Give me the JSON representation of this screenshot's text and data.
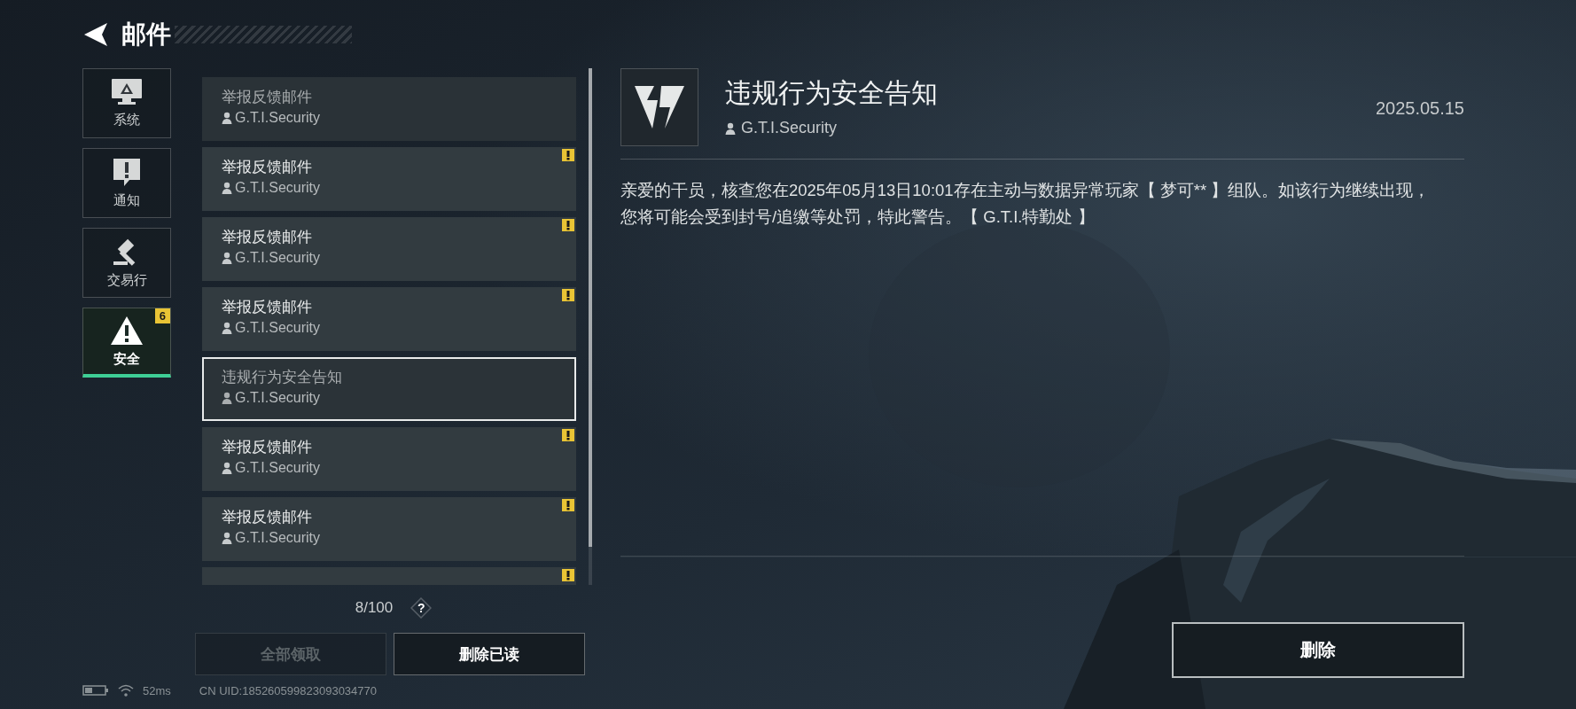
{
  "header": {
    "title": "邮件"
  },
  "tabs": [
    {
      "label": "系统",
      "kind": "monitor",
      "selected": false
    },
    {
      "label": "通知",
      "kind": "notice",
      "selected": false
    },
    {
      "label": "交易行",
      "kind": "hammer",
      "selected": false
    },
    {
      "label": "安全",
      "kind": "warning",
      "selected": true,
      "badge": "6"
    }
  ],
  "mails": [
    {
      "title": "举报反馈邮件",
      "sender": "G.T.I.Security",
      "unread": false,
      "selected": false
    },
    {
      "title": "举报反馈邮件",
      "sender": "G.T.I.Security",
      "unread": true,
      "selected": false
    },
    {
      "title": "举报反馈邮件",
      "sender": "G.T.I.Security",
      "unread": true,
      "selected": false
    },
    {
      "title": "举报反馈邮件",
      "sender": "G.T.I.Security",
      "unread": true,
      "selected": false
    },
    {
      "title": "违规行为安全告知",
      "sender": "G.T.I.Security",
      "unread": false,
      "selected": true
    },
    {
      "title": "举报反馈邮件",
      "sender": "G.T.I.Security",
      "unread": true,
      "selected": false
    },
    {
      "title": "举报反馈邮件",
      "sender": "G.T.I.Security",
      "unread": true,
      "selected": false
    },
    {
      "unread": true,
      "selected": false
    }
  ],
  "counter": "8/100",
  "help": "?",
  "list_buttons": [
    {
      "label": "全部领取",
      "disabled": true
    },
    {
      "label": "删除已读",
      "disabled": false
    }
  ],
  "detail": {
    "title": "违规行为安全告知",
    "sender": "G.T.I.Security",
    "date": "2025.05.15",
    "body": "亲爱的干员，核查您在2025年05月13日10:01存在主动与数据异常玩家【 梦可** 】组队。如该行为继续出现，您将可能会受到封号/追缴等处罚，特此警告。【 G.T.I.特勤处 】",
    "delete_button": "删除"
  },
  "status_bar": {
    "ping": "52ms",
    "uid": "CN UID:185260599823093034770"
  }
}
